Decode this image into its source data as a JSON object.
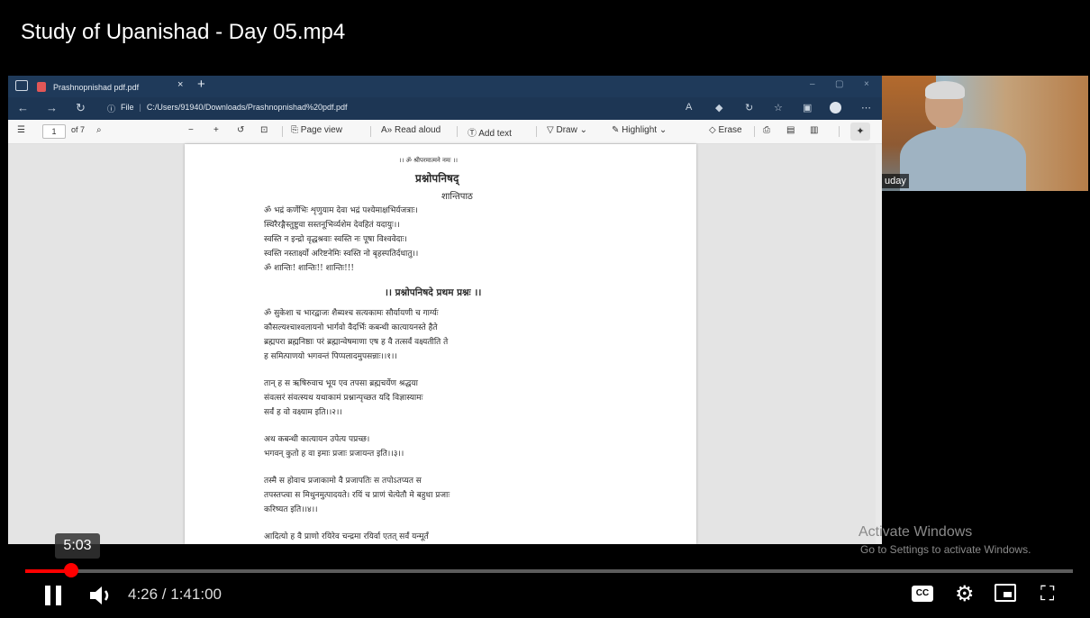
{
  "video": {
    "title": "Study of Upanishad - Day 05.mp4"
  },
  "browser": {
    "tab_label": "Prashnopnishad pdf.pdf",
    "tab_close": "×",
    "new_tab": "+",
    "address_prefix": "File",
    "address_url": "C:/Users/91940/Downloads/Prashnopnishad%20pdf.pdf",
    "window_controls": [
      "–",
      "▢",
      "×"
    ]
  },
  "pdf_toolbar": {
    "page_current": "1",
    "page_total": "of 7",
    "page_view": "Page view",
    "read_aloud": "Read aloud",
    "add_text": "Add text",
    "draw": "Draw",
    "highlight": "Highlight",
    "erase": "Erase"
  },
  "pdf_page": {
    "invocation": "।। ॐ श्रीपरमात्मने नमः ।।",
    "title": "प्रश्नोपनिषद्",
    "shantipath": "शान्तिपाठ",
    "verse_lines": [
      "ॐ भद्रं कर्णेभिः शृणुयाम देवा भद्रं पश्येमाक्षभिर्यजत्राः।",
      "स्थिरैरङ्गैस्तुष्टुवा सस्तनूभिर्व्यशेम देवहितं यदायुः।।",
      "स्वस्ति न इन्द्रो वृद्धश्रवाः स्वस्ति नः पूषा विश्ववेदाः।",
      "स्वस्ति नस्तार्क्ष्यो अरिष्टनेमिः स्वस्ति नो बृहस्पतिर्दधातु।।",
      "ॐ शान्तिः! शान्तिः!! शान्तिः!!!"
    ],
    "chapter_heading": "।। प्रश्नोपनिषदे प्रथम प्रश्नः ।।",
    "para1": [
      "ॐ सुकेशा च भारद्वाजः शैब्यश्च सत्यकामः सौर्यायणी च गार्ग्यः",
      "कौसल्यश्चाश्वलायनो भार्गवो वैदर्भिः कबन्धी कात्यायनस्ते हैते",
      "ब्रह्मपरा ब्रह्मनिष्ठाः परं ब्रह्मान्वेषमाणा एष ह वै तत्सर्वं वक्ष्यतीति ते",
      "ह समित्पाणयो भगवन्तं पिप्पलादमुपसन्नाः।।१।।"
    ],
    "para2": [
      "तान् ह स ऋषिरुवाच भूय एव तपसा ब्रह्मचर्येण श्रद्धया",
      "संवत्सरं संवत्स्यथ यथाकामं प्रश्नान्पृच्छत यदि विज्ञास्यामः",
      "सर्वं ह वो वक्ष्याम इति।।२।।"
    ],
    "para3": [
      "अथ कबन्धी कात्यायन उपेत्य पप्रच्छ।",
      "भगवन् कुतो ह वा इमाः प्रजाः प्रजायन्त इति।।३।।"
    ],
    "para4": [
      "तस्मै स होवाच प्रजाकामो वै प्रजापतिः स तपोऽतप्यत स",
      "तपस्तप्त्वा स मिथुनमुत्पादयते। रयिं च प्राणं चेत्येतौ मे बहुधा प्रजाः",
      "करिष्यत इति।।४।।"
    ],
    "para5": [
      "आदित्यो ह वै प्राणो रयिरेव चन्द्रमा रयिर्वा एतत् सर्वं यन्मूर्तं"
    ]
  },
  "webcam": {
    "name": "uday"
  },
  "watermark": {
    "line1": "Activate Windows",
    "line2": "Go to Settings to activate Windows."
  },
  "player": {
    "hover_time": "5:03",
    "time_display": "4:26 / 1:41:00",
    "cc_label": "CC",
    "progress_played": 0.044,
    "progress_buffered": 0.05
  }
}
